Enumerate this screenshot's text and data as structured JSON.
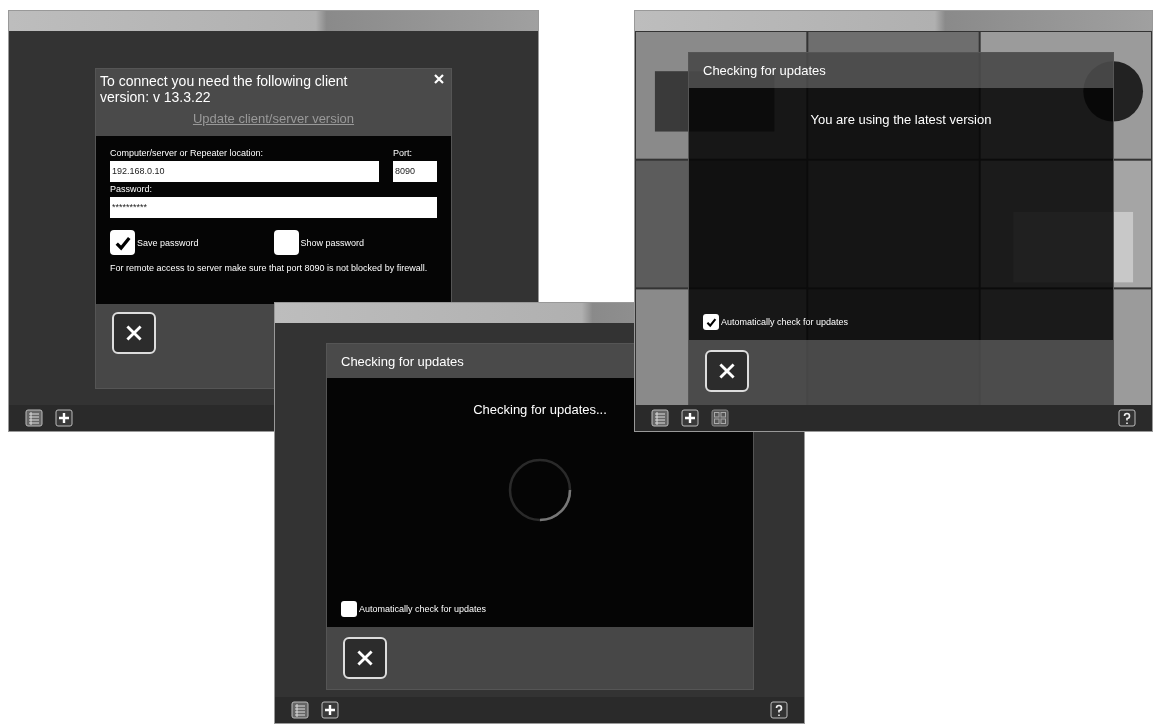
{
  "windows": [
    {
      "kind": "login",
      "dialog": {
        "title": "To connect you need the following client version: v 13.3.22",
        "link": "Update client/server version",
        "location_label": "Computer/server or Repeater location:",
        "location": "192.168.0.10",
        "port_label": "Port:",
        "port": "8090",
        "password_label": "Password:",
        "password": "**********",
        "options": [
          {
            "label": "Save password",
            "checked": true
          },
          {
            "label": "Show password",
            "checked": false
          }
        ],
        "note": "For remote access to server make sure that port 8090 is not blocked by firewall."
      },
      "toolbar": [
        {
          "kind": "list"
        },
        {
          "kind": "add"
        }
      ]
    },
    {
      "kind": "update",
      "dialog": {
        "title": "Checking for updates",
        "message": "Checking for updates...",
        "busy": true,
        "auto_check": {
          "label": "Automatically check for updates",
          "checked": false
        }
      },
      "toolbar": [
        {
          "kind": "list"
        },
        {
          "kind": "add"
        },
        {
          "kind": "help"
        }
      ]
    },
    {
      "kind": "update",
      "camera_view": true,
      "dialog": {
        "title": "Checking for updates",
        "message": "You are using the latest version",
        "busy": false,
        "auto_check": {
          "label": "Automatically check for updates",
          "checked": true
        }
      },
      "toolbar": [
        {
          "kind": "list"
        },
        {
          "kind": "add"
        },
        {
          "kind": "layout"
        },
        {
          "kind": "help"
        }
      ]
    }
  ]
}
